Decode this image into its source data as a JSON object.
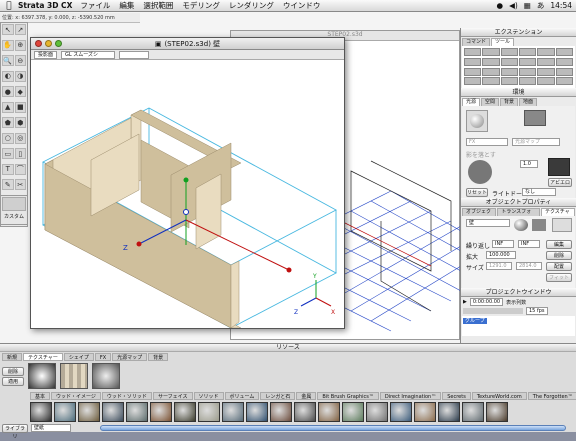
{
  "menubar": {
    "app_name": "Strata 3D CX",
    "items": [
      "ファイル",
      "編集",
      "選択範囲",
      "モデリング",
      "レンダリング",
      "ウインドウ"
    ],
    "clock": "14:54"
  },
  "status": {
    "coords": "位置: x: 6397.378, y: 0.000, z: -5390.520 mm"
  },
  "toolbox": {
    "tools": [
      "↖",
      "↗",
      "✋",
      "⊕",
      "🔍",
      "⊖",
      "◐",
      "◑",
      "●",
      "◆",
      "▲",
      "■",
      "⬟",
      "⬢",
      "○",
      "◎",
      "▭",
      "▯",
      "T",
      "⌒",
      "✎",
      "✂",
      "⬡",
      "↻",
      "◇",
      "▦"
    ],
    "mini_label": "カスタム"
  },
  "window": {
    "title": "(STEP02.s3d) 壁",
    "view_label": "投影面",
    "render_mode": "GL スムーズシ",
    "bg_title": "STEP02.s3d"
  },
  "extension": {
    "title": "エクステンション",
    "tabs": [
      "コマンド",
      "ツール"
    ]
  },
  "environment": {
    "title": "環境",
    "tabs": [
      "光源",
      "空間",
      "背景",
      "地面"
    ],
    "intensity": "1.0",
    "shadow_label": "影を落とす",
    "lightdome_label": "ライトドーム",
    "lightdome_value": "なし",
    "reset_button": "リセット",
    "apply_button": "アピエロ",
    "light_map": "光源マップ"
  },
  "object_properties": {
    "title": "オブジェクトプロパティ",
    "tabs": [
      "オブジェクト",
      "トランスフォーム",
      "テクスチャー"
    ],
    "name": "壁",
    "repeat_label": "繰り返し",
    "size_label": "サイズ",
    "scale_label": "拡大",
    "repeat_value": "INF",
    "scale_value": "100.000",
    "size_values": [
      "1291.0",
      "2814.0"
    ],
    "buttons": [
      "編集",
      "削除",
      "配置",
      "フィット"
    ]
  },
  "project": {
    "title": "プロジェクトウインドウ",
    "time": "0:00:00.00",
    "display_label": "表示列数",
    "fps": "15 fps",
    "group_label": "グループ"
  },
  "resources": {
    "title": "リソース",
    "tabs": [
      "新規",
      "テクスチャー",
      "シェイプ",
      "FX",
      "光源マップ",
      "背景"
    ],
    "side_buttons": [
      "削除",
      "適用"
    ],
    "library_tabs": [
      "基本",
      "ウッド・イメージ",
      "ウッド・ソリッド",
      "サーフェイス",
      "ソリッド",
      "ボリューム",
      "レンガと石",
      "金属",
      "Bit Brush Graphics™",
      "Direct Imagination™",
      "Secrets",
      "TextureWorld.com",
      "The Forgotten™"
    ],
    "library_label": "ライブラリ",
    "library_value": "壁紙"
  },
  "colors": {
    "wall": "#e9dcc0",
    "wall_shade": "#cfbf9c",
    "grid": "#2e4ec8",
    "bbox": "#48b8e0",
    "axis_red": "#c01010",
    "axis_green": "#10a020",
    "axis_blue": "#1030c0"
  }
}
